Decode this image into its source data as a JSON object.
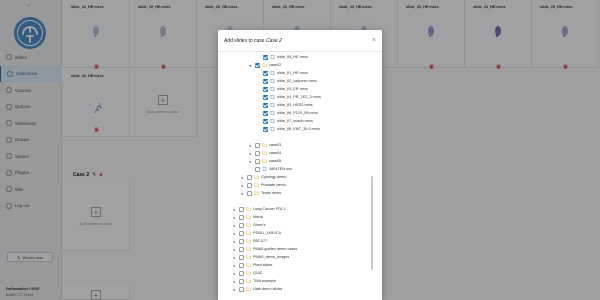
{
  "sidebar": {
    "collapse_icon": "chevron-left-icon",
    "items": [
      {
        "label": "Slides",
        "icon": "slides-icon"
      },
      {
        "label": "Collections",
        "icon": "collections-icon",
        "active": true
      },
      {
        "label": "Courses",
        "icon": "courses-icon"
      },
      {
        "label": "Quizzes",
        "icon": "quiz-icon"
      },
      {
        "label": "Slideboxes",
        "icon": "slidebox-icon"
      },
      {
        "label": "Groups",
        "icon": "groups-icon"
      },
      {
        "label": "Shares",
        "icon": "shares-icon"
      },
      {
        "label": "Plugins",
        "icon": "plugins-icon"
      },
      {
        "label": "Wiki",
        "icon": "wiki-icon"
      },
      {
        "label": "Log out",
        "icon": "logout-icon"
      }
    ],
    "whats_new": "What's new",
    "brand": "Pathomation ©2025",
    "brand_sub": "BuildPC 3.1 Smiley"
  },
  "grid": {
    "row1": [
      "slide_16_HE.mrxs",
      "slide_19_HE.mrxs",
      "slide_20_HE.mrxs",
      "slide_21_HE.mrxs",
      "slide_22_HE.mrxs",
      "slide_23_HE.mrxs",
      "slide_24_HE.mrxs",
      "slide_25_HE.mrxs"
    ],
    "row2_title": "slide_26_HE.mrxs",
    "add_slides_label": "Add slides to case",
    "case2_title": "Case 2"
  },
  "modal": {
    "title_prefix": "Add slides to case ",
    "title_case": "Case 2",
    "close": "×",
    "tree": [
      {
        "label": "slide_05_HE.mrxs",
        "depth": 3,
        "caret": "",
        "checked": true,
        "type": "file"
      },
      {
        "label": "case02",
        "depth": 2,
        "caret": "▾",
        "checked": true,
        "type": "folder"
      },
      {
        "label": "slide_01_HE.mrxs",
        "depth": 3,
        "caret": "",
        "checked": true,
        "type": "file"
      },
      {
        "label": "slide_02_calponin.mrxs",
        "depth": 3,
        "caret": "",
        "checked": true,
        "type": "file"
      },
      {
        "label": "slide_03_ER.mrxs",
        "depth": 3,
        "caret": "",
        "checked": true,
        "type": "file"
      },
      {
        "label": "slide_04_PR_1E2_3.mrxs",
        "depth": 3,
        "caret": "",
        "checked": true,
        "type": "file"
      },
      {
        "label": "slide_05_HER2.mrxs",
        "depth": 3,
        "caret": "",
        "checked": true,
        "type": "file"
      },
      {
        "label": "slide_06_P120_98.mrxs",
        "depth": 3,
        "caret": "",
        "checked": true,
        "type": "file"
      },
      {
        "label": "slide_07_ecadh.mrxs",
        "depth": 3,
        "caret": "",
        "checked": true,
        "type": "file"
      },
      {
        "label": "slide_08_Ki67_30-9.mrxs",
        "depth": 3,
        "caret": "",
        "checked": true,
        "type": "file"
      },
      {
        "label": "",
        "depth": 2,
        "caret": "",
        "checked": false,
        "type": "spacer"
      },
      {
        "label": "case03",
        "depth": 2,
        "caret": "▸",
        "checked": false,
        "type": "folder"
      },
      {
        "label": "case04",
        "depth": 2,
        "caret": "▸",
        "checked": false,
        "type": "folder"
      },
      {
        "label": "case05",
        "depth": 2,
        "caret": "▸",
        "checked": false,
        "type": "folder"
      },
      {
        "label": "1804TEN.svs",
        "depth": 2,
        "caret": "",
        "checked": false,
        "type": "file"
      },
      {
        "label": "Cytology demo",
        "depth": 1,
        "caret": "▸",
        "checked": false,
        "type": "folder"
      },
      {
        "label": "Prostate demo",
        "depth": 1,
        "caret": "▸",
        "checked": false,
        "type": "folder"
      },
      {
        "label": "Testis demo",
        "depth": 1,
        "caret": "▸",
        "checked": false,
        "type": "folder"
      },
      {
        "label": "",
        "depth": 1,
        "caret": "",
        "checked": false,
        "type": "spacer"
      },
      {
        "label": "Lung Cancer PDL1",
        "depth": 0,
        "caret": "▸",
        "checked": false,
        "type": "folder"
      },
      {
        "label": "Merck",
        "depth": 0,
        "caret": "▸",
        "checked": false,
        "type": "folder"
      },
      {
        "label": "Oliver's",
        "depth": 0,
        "caret": "▸",
        "checked": false,
        "type": "folder"
      },
      {
        "label": "PS061_1K8VCA",
        "depth": 0,
        "caret": "▸",
        "checked": false,
        "type": "folder"
      },
      {
        "label": "PAT-077",
        "depth": 0,
        "caret": "▸",
        "checked": false,
        "type": "folder"
      },
      {
        "label": "PMA5 golden demo cases",
        "depth": 0,
        "caret": "▸",
        "checked": false,
        "type": "folder"
      },
      {
        "label": "PMA5_demo_images",
        "depth": 0,
        "caret": "▸",
        "checked": false,
        "type": "folder"
      },
      {
        "label": "Plant slides",
        "depth": 0,
        "caret": "▸",
        "checked": false,
        "type": "folder"
      },
      {
        "label": "QUIZ",
        "depth": 0,
        "caret": "▸",
        "checked": false,
        "type": "folder"
      },
      {
        "label": "TMA example",
        "depth": 0,
        "caret": "▸",
        "checked": false,
        "type": "folder"
      },
      {
        "label": "Utah demo slides",
        "depth": 0,
        "caret": "▸",
        "checked": false,
        "type": "folder"
      }
    ]
  },
  "colors": {
    "accent": "#2c6fb5",
    "trash": "#d9534f",
    "folder": "#e8b84a"
  }
}
